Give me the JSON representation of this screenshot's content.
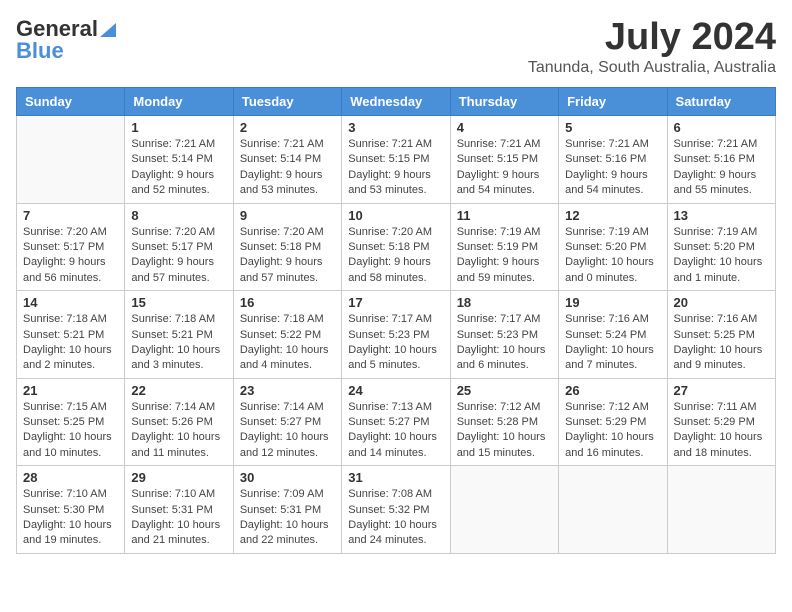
{
  "header": {
    "logo_general": "General",
    "logo_blue": "Blue",
    "month_year": "July 2024",
    "location": "Tanunda, South Australia, Australia"
  },
  "weekdays": [
    "Sunday",
    "Monday",
    "Tuesday",
    "Wednesday",
    "Thursday",
    "Friday",
    "Saturday"
  ],
  "weeks": [
    [
      {
        "day": "",
        "info": ""
      },
      {
        "day": "1",
        "info": "Sunrise: 7:21 AM\nSunset: 5:14 PM\nDaylight: 9 hours\nand 52 minutes."
      },
      {
        "day": "2",
        "info": "Sunrise: 7:21 AM\nSunset: 5:14 PM\nDaylight: 9 hours\nand 53 minutes."
      },
      {
        "day": "3",
        "info": "Sunrise: 7:21 AM\nSunset: 5:15 PM\nDaylight: 9 hours\nand 53 minutes."
      },
      {
        "day": "4",
        "info": "Sunrise: 7:21 AM\nSunset: 5:15 PM\nDaylight: 9 hours\nand 54 minutes."
      },
      {
        "day": "5",
        "info": "Sunrise: 7:21 AM\nSunset: 5:16 PM\nDaylight: 9 hours\nand 54 minutes."
      },
      {
        "day": "6",
        "info": "Sunrise: 7:21 AM\nSunset: 5:16 PM\nDaylight: 9 hours\nand 55 minutes."
      }
    ],
    [
      {
        "day": "7",
        "info": "Sunrise: 7:20 AM\nSunset: 5:17 PM\nDaylight: 9 hours\nand 56 minutes."
      },
      {
        "day": "8",
        "info": "Sunrise: 7:20 AM\nSunset: 5:17 PM\nDaylight: 9 hours\nand 57 minutes."
      },
      {
        "day": "9",
        "info": "Sunrise: 7:20 AM\nSunset: 5:18 PM\nDaylight: 9 hours\nand 57 minutes."
      },
      {
        "day": "10",
        "info": "Sunrise: 7:20 AM\nSunset: 5:18 PM\nDaylight: 9 hours\nand 58 minutes."
      },
      {
        "day": "11",
        "info": "Sunrise: 7:19 AM\nSunset: 5:19 PM\nDaylight: 9 hours\nand 59 minutes."
      },
      {
        "day": "12",
        "info": "Sunrise: 7:19 AM\nSunset: 5:20 PM\nDaylight: 10 hours\nand 0 minutes."
      },
      {
        "day": "13",
        "info": "Sunrise: 7:19 AM\nSunset: 5:20 PM\nDaylight: 10 hours\nand 1 minute."
      }
    ],
    [
      {
        "day": "14",
        "info": "Sunrise: 7:18 AM\nSunset: 5:21 PM\nDaylight: 10 hours\nand 2 minutes."
      },
      {
        "day": "15",
        "info": "Sunrise: 7:18 AM\nSunset: 5:21 PM\nDaylight: 10 hours\nand 3 minutes."
      },
      {
        "day": "16",
        "info": "Sunrise: 7:18 AM\nSunset: 5:22 PM\nDaylight: 10 hours\nand 4 minutes."
      },
      {
        "day": "17",
        "info": "Sunrise: 7:17 AM\nSunset: 5:23 PM\nDaylight: 10 hours\nand 5 minutes."
      },
      {
        "day": "18",
        "info": "Sunrise: 7:17 AM\nSunset: 5:23 PM\nDaylight: 10 hours\nand 6 minutes."
      },
      {
        "day": "19",
        "info": "Sunrise: 7:16 AM\nSunset: 5:24 PM\nDaylight: 10 hours\nand 7 minutes."
      },
      {
        "day": "20",
        "info": "Sunrise: 7:16 AM\nSunset: 5:25 PM\nDaylight: 10 hours\nand 9 minutes."
      }
    ],
    [
      {
        "day": "21",
        "info": "Sunrise: 7:15 AM\nSunset: 5:25 PM\nDaylight: 10 hours\nand 10 minutes."
      },
      {
        "day": "22",
        "info": "Sunrise: 7:14 AM\nSunset: 5:26 PM\nDaylight: 10 hours\nand 11 minutes."
      },
      {
        "day": "23",
        "info": "Sunrise: 7:14 AM\nSunset: 5:27 PM\nDaylight: 10 hours\nand 12 minutes."
      },
      {
        "day": "24",
        "info": "Sunrise: 7:13 AM\nSunset: 5:27 PM\nDaylight: 10 hours\nand 14 minutes."
      },
      {
        "day": "25",
        "info": "Sunrise: 7:12 AM\nSunset: 5:28 PM\nDaylight: 10 hours\nand 15 minutes."
      },
      {
        "day": "26",
        "info": "Sunrise: 7:12 AM\nSunset: 5:29 PM\nDaylight: 10 hours\nand 16 minutes."
      },
      {
        "day": "27",
        "info": "Sunrise: 7:11 AM\nSunset: 5:29 PM\nDaylight: 10 hours\nand 18 minutes."
      }
    ],
    [
      {
        "day": "28",
        "info": "Sunrise: 7:10 AM\nSunset: 5:30 PM\nDaylight: 10 hours\nand 19 minutes."
      },
      {
        "day": "29",
        "info": "Sunrise: 7:10 AM\nSunset: 5:31 PM\nDaylight: 10 hours\nand 21 minutes."
      },
      {
        "day": "30",
        "info": "Sunrise: 7:09 AM\nSunset: 5:31 PM\nDaylight: 10 hours\nand 22 minutes."
      },
      {
        "day": "31",
        "info": "Sunrise: 7:08 AM\nSunset: 5:32 PM\nDaylight: 10 hours\nand 24 minutes."
      },
      {
        "day": "",
        "info": ""
      },
      {
        "day": "",
        "info": ""
      },
      {
        "day": "",
        "info": ""
      }
    ]
  ]
}
